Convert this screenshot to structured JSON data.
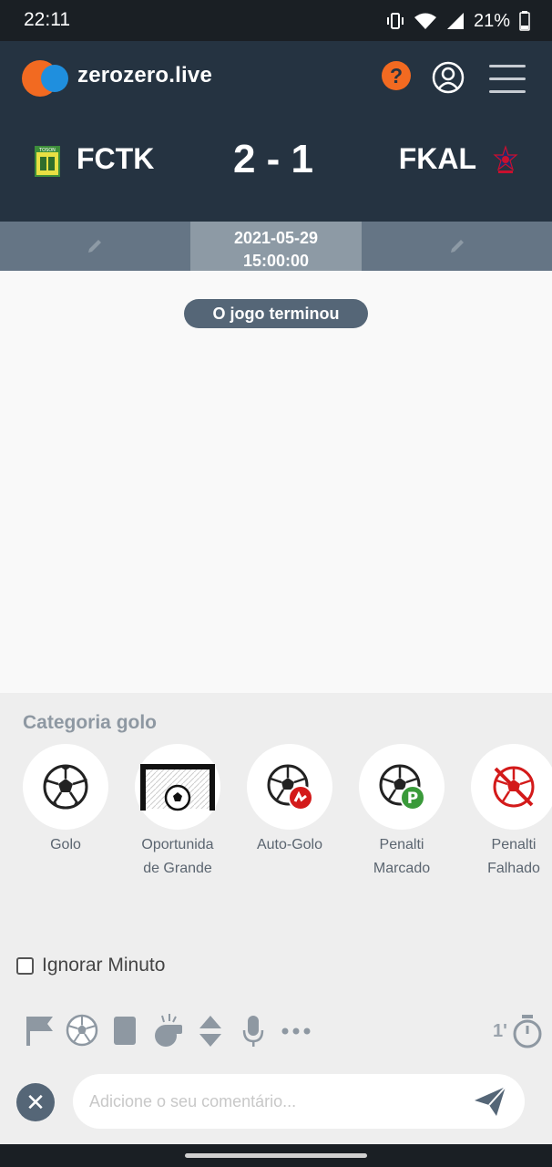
{
  "status_bar": {
    "time": "22:11",
    "battery": "21%"
  },
  "header": {
    "brand": "zerozero.live",
    "help_glyph": "?",
    "home_team": {
      "name": "FCTK",
      "crest_text": "TOSON"
    },
    "score": "2 - 1",
    "away_team": {
      "name": "FKAL"
    }
  },
  "match": {
    "date": "2021-05-29",
    "time": "15:00:00",
    "status": "O jogo terminou"
  },
  "category": {
    "title": "Categoria golo",
    "items": [
      {
        "label": "Golo",
        "icon": "soccer-ball-icon"
      },
      {
        "label": "Oportunida de Grande",
        "icon": "goal-chance-icon"
      },
      {
        "label": "Auto-Golo",
        "icon": "own-goal-icon"
      },
      {
        "label": "Penalti Marcado",
        "icon": "penalty-scored-icon"
      },
      {
        "label": "Penalti Falhado",
        "icon": "penalty-missed-icon"
      }
    ]
  },
  "ignore_minute": {
    "label": "Ignorar Minuto",
    "checked": false
  },
  "toolbar": {
    "icons": [
      "flag-icon",
      "soccer-ball-icon",
      "card-icon",
      "whistle-icon",
      "substitution-icon",
      "microphone-icon",
      "more-icon"
    ],
    "minute": "1'"
  },
  "comment": {
    "placeholder": "Adicione o seu comentário..."
  },
  "close_glyph": "✕",
  "colors": {
    "header": "#253341",
    "accent_orange": "#f26a21",
    "accent_blue": "#1f8fde",
    "pill": "#556677"
  }
}
